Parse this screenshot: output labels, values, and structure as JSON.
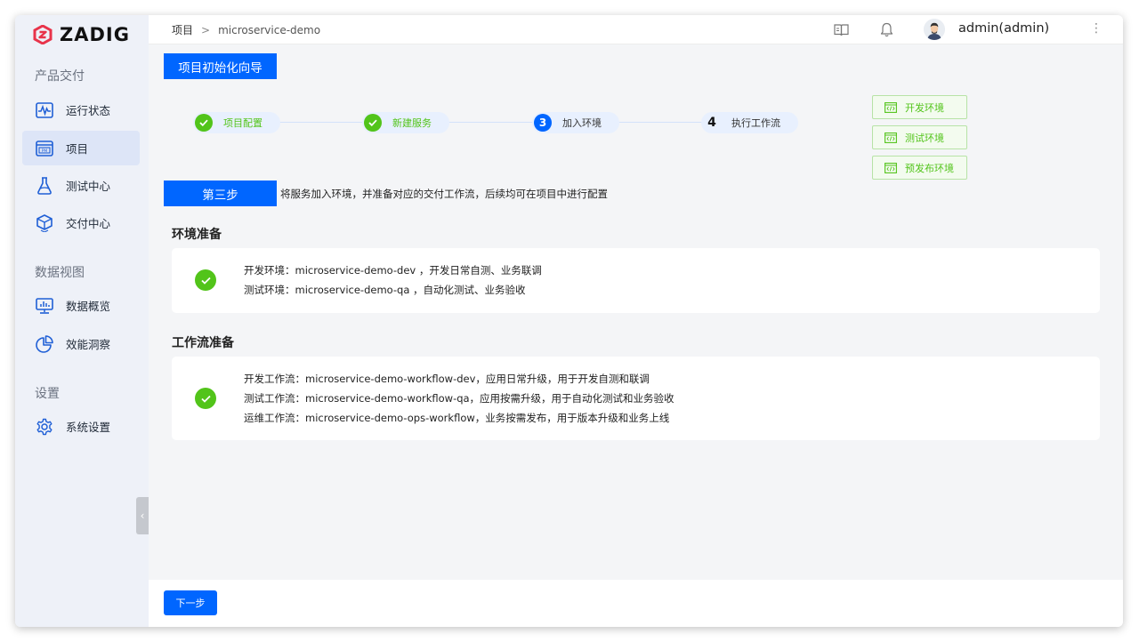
{
  "brand": {
    "name": "ZADIG",
    "accent": "#0066ff",
    "logo_color": "#e8334a"
  },
  "sidebar": {
    "groups": [
      {
        "title": "产品交付",
        "items": [
          {
            "label": "运行状态",
            "icon": "waveform-icon"
          },
          {
            "label": "项目",
            "icon": "project-icon",
            "active": true
          },
          {
            "label": "测试中心",
            "icon": "flask-icon"
          },
          {
            "label": "交付中心",
            "icon": "package-icon"
          }
        ]
      },
      {
        "title": "数据视图",
        "items": [
          {
            "label": "数据概览",
            "icon": "monitor-chart-icon"
          },
          {
            "label": "效能洞察",
            "icon": "pie-chart-icon"
          }
        ]
      },
      {
        "title": "设置",
        "items": [
          {
            "label": "系统设置",
            "icon": "gear-icon"
          }
        ]
      }
    ]
  },
  "header": {
    "breadcrumb": {
      "root": "项目",
      "separator": ">",
      "current": "microservice-demo"
    },
    "user": "admin(admin)"
  },
  "wizard": {
    "title": "项目初始化向导",
    "steps": [
      {
        "label": "项目配置",
        "state": "done"
      },
      {
        "label": "新建服务",
        "state": "done"
      },
      {
        "number": "3",
        "label": "加入环境",
        "state": "current"
      },
      {
        "number": "4",
        "label": "执行工作流",
        "state": "todo"
      }
    ],
    "env_buttons": [
      "开发环境",
      "测试环境",
      "预发布环境"
    ],
    "step_title": "第三步",
    "step_desc": "将服务加入环境，并准备对应的交付工作流，后续均可在项目中进行配置"
  },
  "sections": {
    "env": {
      "title": "环境准备",
      "lines": [
        "开发环境：microservice-demo-dev ，开发日常自测、业务联调",
        "测试环境：microservice-demo-qa ，自动化测试、业务验收"
      ]
    },
    "workflow": {
      "title": "工作流准备",
      "lines": [
        "开发工作流：microservice-demo-workflow-dev，应用日常升级，用于开发自测和联调",
        "测试工作流：microservice-demo-workflow-qa，应用按需升级，用于自动化测试和业务验收",
        "运维工作流：microservice-demo-ops-workflow，业务按需发布，用于版本升级和业务上线"
      ]
    }
  },
  "footer": {
    "next_label": "下一步"
  }
}
